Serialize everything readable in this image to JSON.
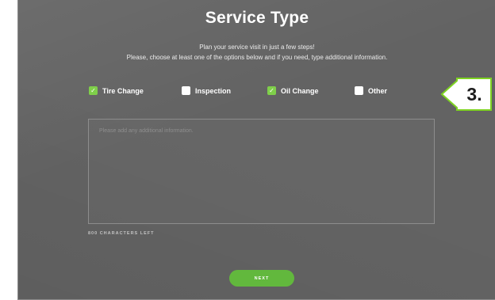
{
  "form": {
    "title": "Service Type",
    "intro_line1": "Plan your service visit in just a few steps!",
    "intro_line2": "Please, choose at least one of the options below and if you need, type additional information.",
    "options": [
      {
        "label": "Tire Change",
        "checked": true
      },
      {
        "label": "Inspection",
        "checked": false
      },
      {
        "label": "Oil Change",
        "checked": true
      },
      {
        "label": "Other",
        "checked": false
      }
    ],
    "textarea_placeholder": "Please add any additional information.",
    "chars_left": "800 CHARACTERS LEFT",
    "next_label": "NEXT"
  },
  "callout": {
    "label": "3.",
    "color": "#7ed321"
  },
  "colors": {
    "panel_bg": "#636363",
    "accent_green": "#62b83d",
    "checkbox_checked": "#7fcf4a"
  }
}
